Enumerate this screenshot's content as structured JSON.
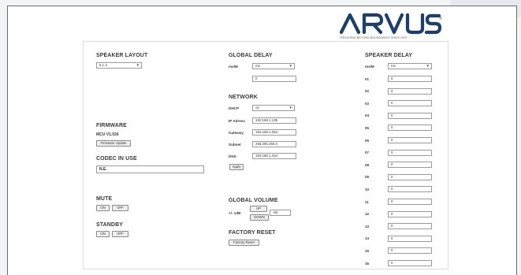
{
  "brand": {
    "logo": "ARVUS",
    "tagline": "REACHING BEYOND BOUNDARIES SINCE 2002",
    "reg": "®"
  },
  "speaker_layout": {
    "title": "SPEAKER LAYOUT",
    "value": "5.1.4"
  },
  "firmware": {
    "title": "FIRMWARE",
    "version": "MCU V1.026",
    "update_button": "Firmware Update"
  },
  "codec": {
    "title": "CODEC IN USE",
    "value": "N.E."
  },
  "mute": {
    "title": "MUTE",
    "on": "ON",
    "off": "OFF"
  },
  "standby": {
    "title": "STANDBY",
    "on": "ON",
    "off": "OFF"
  },
  "global_delay": {
    "title": "GLOBAL DELAY",
    "unit_label": "ms/M",
    "unit_value": "ms",
    "value": "0"
  },
  "network": {
    "title": "NETWORK",
    "dhcp_label": "DHCP",
    "dhcp_value": "on",
    "ip_label": "IP Adress",
    "ip_value": "192.168.1.135",
    "gateway_label": "Gateway",
    "gateway_value": "192.168.1.254",
    "subnet_label": "Subnet",
    "subnet_value": "255.255.255.0",
    "dns_label": "DNS",
    "dns_value": "192.168.1.254",
    "apply_button": "Apply"
  },
  "global_volume": {
    "title": "GLOBAL VOLUME",
    "label": "+/- 1dB",
    "up": "UP",
    "down": "DOWN",
    "value": "-60"
  },
  "factory_reset": {
    "title": "FACTORY RESET",
    "button": "Factory Reset"
  },
  "speaker_delay": {
    "title": "SPEAKER DELAY",
    "unit_label": "ms/M",
    "unit_value": "ms",
    "channels": [
      {
        "label": "01",
        "value": "0"
      },
      {
        "label": "02",
        "value": "0"
      },
      {
        "label": "03",
        "value": "0"
      },
      {
        "label": "04",
        "value": "0"
      },
      {
        "label": "05",
        "value": "0"
      },
      {
        "label": "06",
        "value": "0"
      },
      {
        "label": "07",
        "value": "0"
      },
      {
        "label": "08",
        "value": "0"
      },
      {
        "label": "09",
        "value": "0"
      },
      {
        "label": "10",
        "value": "0"
      },
      {
        "label": "11",
        "value": "0"
      },
      {
        "label": "12",
        "value": "0"
      },
      {
        "label": "13",
        "value": "0"
      },
      {
        "label": "14",
        "value": "0"
      },
      {
        "label": "15",
        "value": "0"
      },
      {
        "label": "16",
        "value": "0"
      }
    ]
  }
}
